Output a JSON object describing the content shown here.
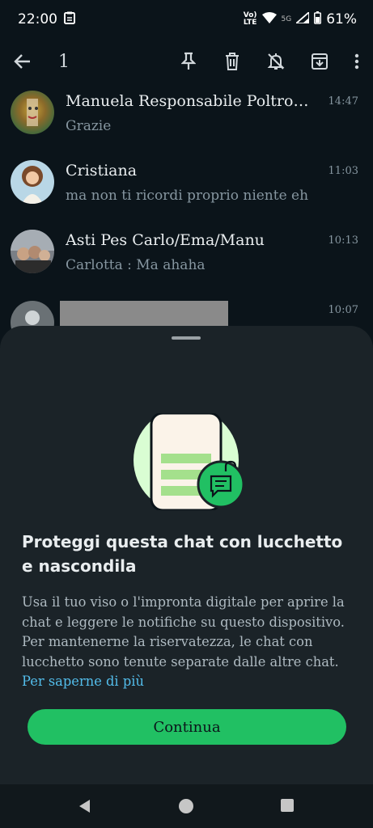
{
  "status_bar": {
    "time": "22:00",
    "network_top": "Vo)",
    "network_bottom": "LTE",
    "signal_label": "5G",
    "battery": "61%"
  },
  "action_bar": {
    "selected_count": "1",
    "icons": [
      "back-arrow-icon",
      "pin-icon",
      "delete-icon",
      "mute-icon",
      "archive-icon",
      "more-icon"
    ]
  },
  "chats": [
    {
      "name": "Manuela Responsabile Poltron...",
      "time": "14:47",
      "preview": "Grazie"
    },
    {
      "name": "Cristiana",
      "time": "11:03",
      "preview": "ma non ti ricordi proprio niente eh"
    },
    {
      "name": "Asti Pes Carlo/Ema/Manu",
      "time": "10:13",
      "preview": "Carlotta : Ma ahaha"
    },
    {
      "name": "",
      "time": "10:07",
      "preview": ""
    }
  ],
  "sheet": {
    "title": "Proteggi questa chat con lucchetto e nascondila",
    "body": "Usa il tuo viso o l'impronta digitale per aprire la chat e leggere le notifiche su questo dispositivo. Per mantenerne la riservatezza, le chat con lucchetto sono tenute separate dalle altre chat.",
    "learn_more": "Per saperne di più",
    "continue_label": "Continua"
  },
  "colors": {
    "background": "#0b141a",
    "sheet": "#1b2328",
    "accent_green": "#21c063",
    "link_blue": "#53bdeb"
  }
}
